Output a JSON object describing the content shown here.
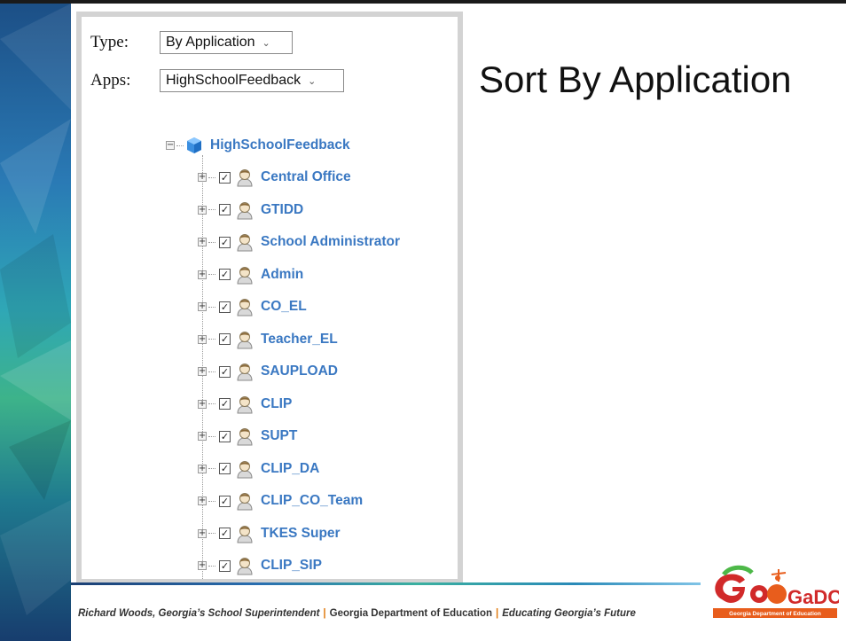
{
  "form": {
    "type_label": "Type:",
    "type_value": "By Application",
    "apps_label": "Apps:",
    "apps_value": "HighSchoolFeedback"
  },
  "tree": {
    "root_label": "HighSchoolFeedback",
    "items": [
      {
        "label": "Central Office",
        "checked": true
      },
      {
        "label": "GTIDD",
        "checked": true
      },
      {
        "label": "School Administrator",
        "checked": true
      },
      {
        "label": "Admin",
        "checked": true
      },
      {
        "label": "CO_EL",
        "checked": true
      },
      {
        "label": "Teacher_EL",
        "checked": true
      },
      {
        "label": "SAUPLOAD",
        "checked": true
      },
      {
        "label": "CLIP",
        "checked": true
      },
      {
        "label": "SUPT",
        "checked": true
      },
      {
        "label": "CLIP_DA",
        "checked": true
      },
      {
        "label": "CLIP_CO_Team",
        "checked": true
      },
      {
        "label": "TKES Super",
        "checked": true
      },
      {
        "label": "CLIP_SIP",
        "checked": true
      }
    ]
  },
  "slide": {
    "title": "Sort By Application"
  },
  "footer": {
    "superintendent": "Richard Woods, Georgia’s School Superintendent",
    "separator": "|",
    "department": "Georgia Department of Education",
    "motto": "Educating Georgia’s Future"
  },
  "logo": {
    "brand": "GaDOE",
    "caption": "Georgia Department of Education"
  },
  "colors": {
    "link_blue": "#3a78c2",
    "accent_orange": "#e07b10",
    "panel_border": "#d3d3d3"
  }
}
